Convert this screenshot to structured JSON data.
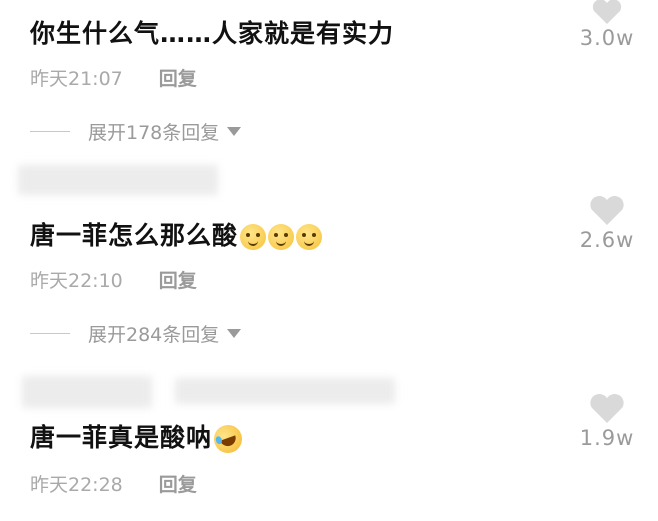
{
  "comments": [
    {
      "text": "你生什么气……人家就是有实力",
      "time": "昨天21:07",
      "reply": "回复",
      "expand": "展开178条回复",
      "likes": "3.0w"
    },
    {
      "text": "唐一菲怎么那么酸",
      "time": "昨天22:10",
      "reply": "回复",
      "expand": "展开284条回复",
      "likes": "2.6w",
      "emoji": "smile-emoji x3"
    },
    {
      "text": "唐一菲真是酸呐",
      "time": "昨天22:28",
      "reply": "回复",
      "likes": "1.9w",
      "emoji": "laughing-tears-emoji"
    }
  ],
  "colors": {
    "heart": "#d9d9d9",
    "meta": "#a9a9a9",
    "text": "#111111"
  }
}
